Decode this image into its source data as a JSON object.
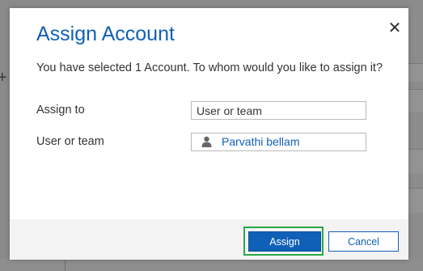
{
  "dialog": {
    "title": "Assign Account",
    "description": "You have selected 1 Account. To whom would you like to assign it?",
    "close_icon": "✕"
  },
  "form": {
    "assign_to": {
      "label": "Assign to",
      "value": "User or team"
    },
    "user_or_team": {
      "label": "User or team",
      "value": "Parvathi bellam",
      "icon": "user-icon"
    }
  },
  "footer": {
    "assign_label": "Assign",
    "cancel_label": "Cancel"
  },
  "colors": {
    "accent": "#1160b7",
    "highlight_frame": "#2aa84a"
  }
}
